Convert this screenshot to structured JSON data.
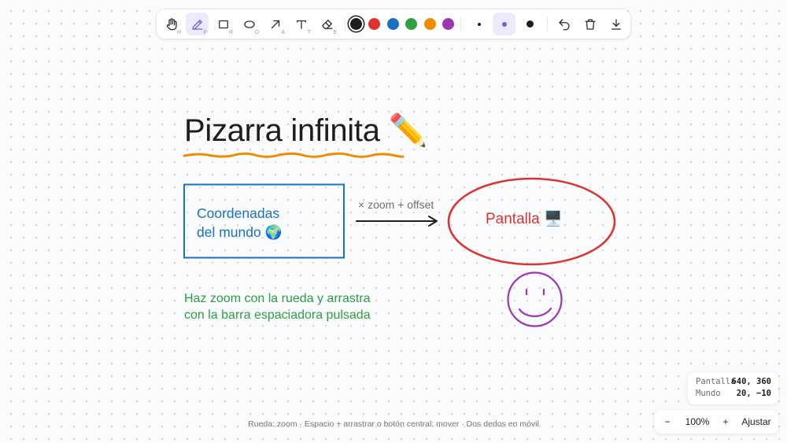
{
  "toolbar": {
    "tools": [
      {
        "name": "hand-tool",
        "icon": "hand-icon",
        "shortcut": "H",
        "active": false
      },
      {
        "name": "pencil-tool",
        "icon": "pencil-icon",
        "shortcut": "P",
        "active": true
      },
      {
        "name": "rectangle-tool",
        "icon": "rectangle-icon",
        "shortcut": "R",
        "active": false
      },
      {
        "name": "ellipse-tool",
        "icon": "ellipse-icon",
        "shortcut": "O",
        "active": false
      },
      {
        "name": "arrow-tool",
        "icon": "arrow-icon",
        "shortcut": "A",
        "active": false
      },
      {
        "name": "text-tool",
        "icon": "text-icon",
        "shortcut": "T",
        "active": false
      },
      {
        "name": "eraser-tool",
        "icon": "eraser-icon",
        "shortcut": "E",
        "active": false
      }
    ],
    "colors": [
      {
        "name": "black",
        "hex": "#1e1e1e",
        "selected": true
      },
      {
        "name": "red",
        "hex": "#e03131",
        "selected": false
      },
      {
        "name": "blue",
        "hex": "#1971c2",
        "selected": false
      },
      {
        "name": "green",
        "hex": "#2f9e44",
        "selected": false
      },
      {
        "name": "orange",
        "hex": "#f08c00",
        "selected": false
      },
      {
        "name": "purple",
        "hex": "#9c36b5",
        "selected": false
      }
    ],
    "stroke_sizes": [
      {
        "name": "small",
        "selected": false
      },
      {
        "name": "medium",
        "selected": true
      },
      {
        "name": "large",
        "selected": false
      }
    ],
    "actions": [
      {
        "name": "undo",
        "icon": "undo-icon"
      },
      {
        "name": "clear",
        "icon": "trash-icon"
      },
      {
        "name": "export",
        "icon": "download-icon"
      }
    ]
  },
  "canvas": {
    "title": "Pizarra infinita ✏️",
    "box_text_line1": "Coordenadas",
    "box_text_line2": "del mundo 🌍",
    "arrow_label": "× zoom + offset",
    "ellipse_text": "Pantalla 🖥️",
    "note_line1": "Haz zoom con la rueda y arrastra",
    "note_line2": "con la barra espaciadora pulsada"
  },
  "coords": {
    "screen_label": "Pantalla",
    "screen_value": "640, 360",
    "world_label": "Mundo",
    "world_value": "20, −10"
  },
  "zoom": {
    "minus": "−",
    "level": "100%",
    "plus": "+",
    "fit": "Ajustar"
  },
  "hint": "Rueda: zoom · Espacio + arrastrar o botón central: mover · Dos dedos en móvil",
  "colors": {
    "accent": "#6d63d8",
    "title_underline": "#f08c00"
  }
}
